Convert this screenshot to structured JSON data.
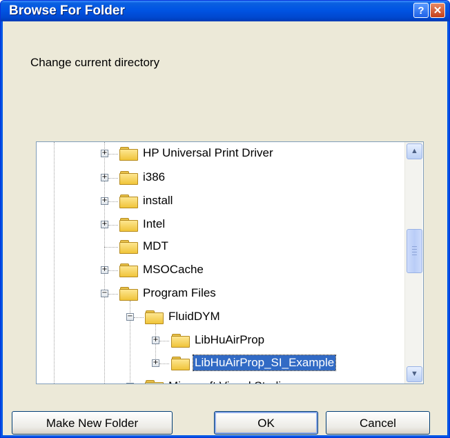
{
  "window": {
    "title": "Browse For Folder",
    "help_label": "?",
    "close_label": "✕"
  },
  "prompt": "Change current directory",
  "tree": {
    "items": [
      {
        "label": "HP Universal Print Driver",
        "expander": "+"
      },
      {
        "label": "i386",
        "expander": "+"
      },
      {
        "label": "install",
        "expander": "+"
      },
      {
        "label": "Intel",
        "expander": "+"
      },
      {
        "label": "MDT",
        "expander": ""
      },
      {
        "label": "MSOCache",
        "expander": "+"
      },
      {
        "label": "Program Files",
        "expander": "−"
      },
      {
        "label": "FluidDYM",
        "expander": "−"
      },
      {
        "label": "LibHuAirProp",
        "expander": "+"
      },
      {
        "label": "LibHuAirProp_SI_Example",
        "expander": "+",
        "selected": true
      },
      {
        "label": "Microsoft Visual Studio",
        "expander": "−"
      }
    ]
  },
  "scrollbar": {
    "up_label": "▲",
    "down_label": "▼"
  },
  "buttons": {
    "make_new_folder": "Make New Folder",
    "ok": "OK",
    "cancel": "Cancel"
  }
}
